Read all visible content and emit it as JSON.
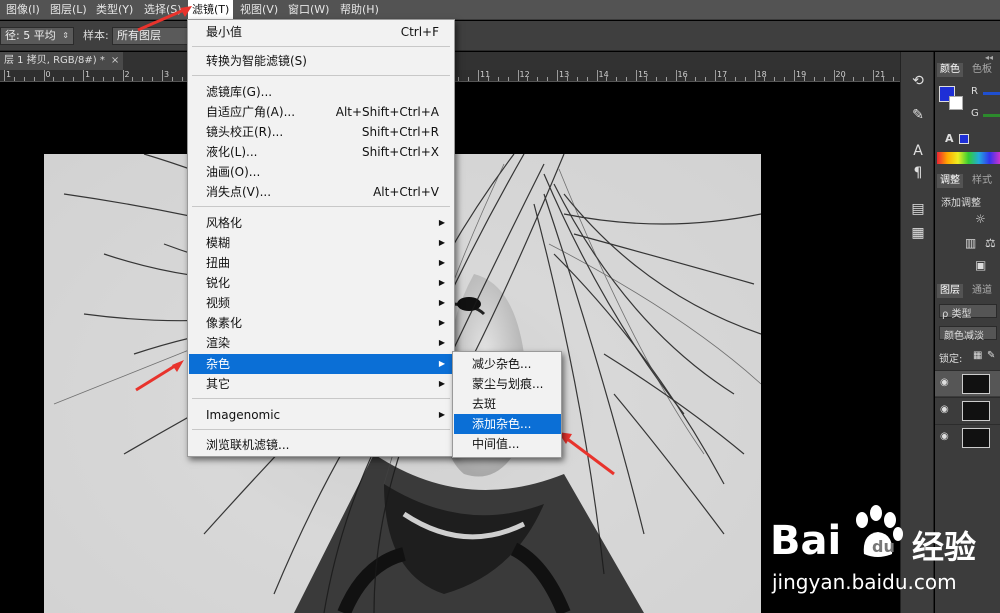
{
  "menubar": {
    "items": [
      "图像(I)",
      "图层(L)",
      "类型(Y)",
      "选择(S)",
      "滤镜(T)",
      "视图(V)",
      "窗口(W)",
      "帮助(H)"
    ]
  },
  "optbar": {
    "radius_select": "径: 5 平均",
    "sample_label": "样本:",
    "sample_select": "所有图层"
  },
  "document": {
    "tab_label": "层 1 拷贝, RGB/8#) *",
    "ruler_numbers": [
      "1",
      "0",
      "1",
      "2",
      "3",
      "4",
      "5",
      "6",
      "7",
      "8",
      "9",
      "10",
      "11",
      "12",
      "13",
      "14",
      "15",
      "16",
      "17",
      "18",
      "19",
      "20",
      "21",
      "22"
    ]
  },
  "filter_menu": {
    "last_filter": {
      "label": "最小值",
      "shortcut": "Ctrl+F"
    },
    "smart_filter": {
      "label": "转换为智能滤镜(S)"
    },
    "gallery": {
      "label": "滤镜库(G)..."
    },
    "adaptive_wide": {
      "label": "自适应广角(A)...",
      "shortcut": "Alt+Shift+Ctrl+A"
    },
    "lens_correction": {
      "label": "镜头校正(R)...",
      "shortcut": "Shift+Ctrl+R"
    },
    "liquify": {
      "label": "液化(L)...",
      "shortcut": "Shift+Ctrl+X"
    },
    "oil_paint": {
      "label": "油画(O)..."
    },
    "vanishing_point": {
      "label": "消失点(V)...",
      "shortcut": "Alt+Ctrl+V"
    },
    "submenus": [
      "风格化",
      "模糊",
      "扭曲",
      "锐化",
      "视频",
      "像素化",
      "渲染",
      "杂色",
      "其它"
    ],
    "imagenomic": {
      "label": "Imagenomic"
    },
    "browse_online": {
      "label": "浏览联机滤镜..."
    }
  },
  "noise_menu": {
    "items": [
      "减少杂色...",
      "蒙尘与划痕...",
      "去斑",
      "添加杂色...",
      "中间值..."
    ]
  },
  "panels": {
    "color_tab": "颜色",
    "swatches_tab": "色板",
    "r_label": "R",
    "g_label": "G",
    "adjust_tab": "调整",
    "styles_tab": "样式",
    "add_adjust": "添加调整",
    "layers_tab": "图层",
    "channels_tab": "通道",
    "kind_filter": "ρ 类型",
    "blend_mode": "颜色减淡",
    "lock_label": "锁定:",
    "collapse_arrows": "◂◂"
  },
  "watermark": {
    "brand_left": "Bai",
    "brand_right": "经验",
    "url": "jingyan.baidu.com"
  },
  "colors": {
    "highlight": "#0b6fd6",
    "annotation_arrow": "#e8332c",
    "foreground_color": "#1e2fd6"
  }
}
